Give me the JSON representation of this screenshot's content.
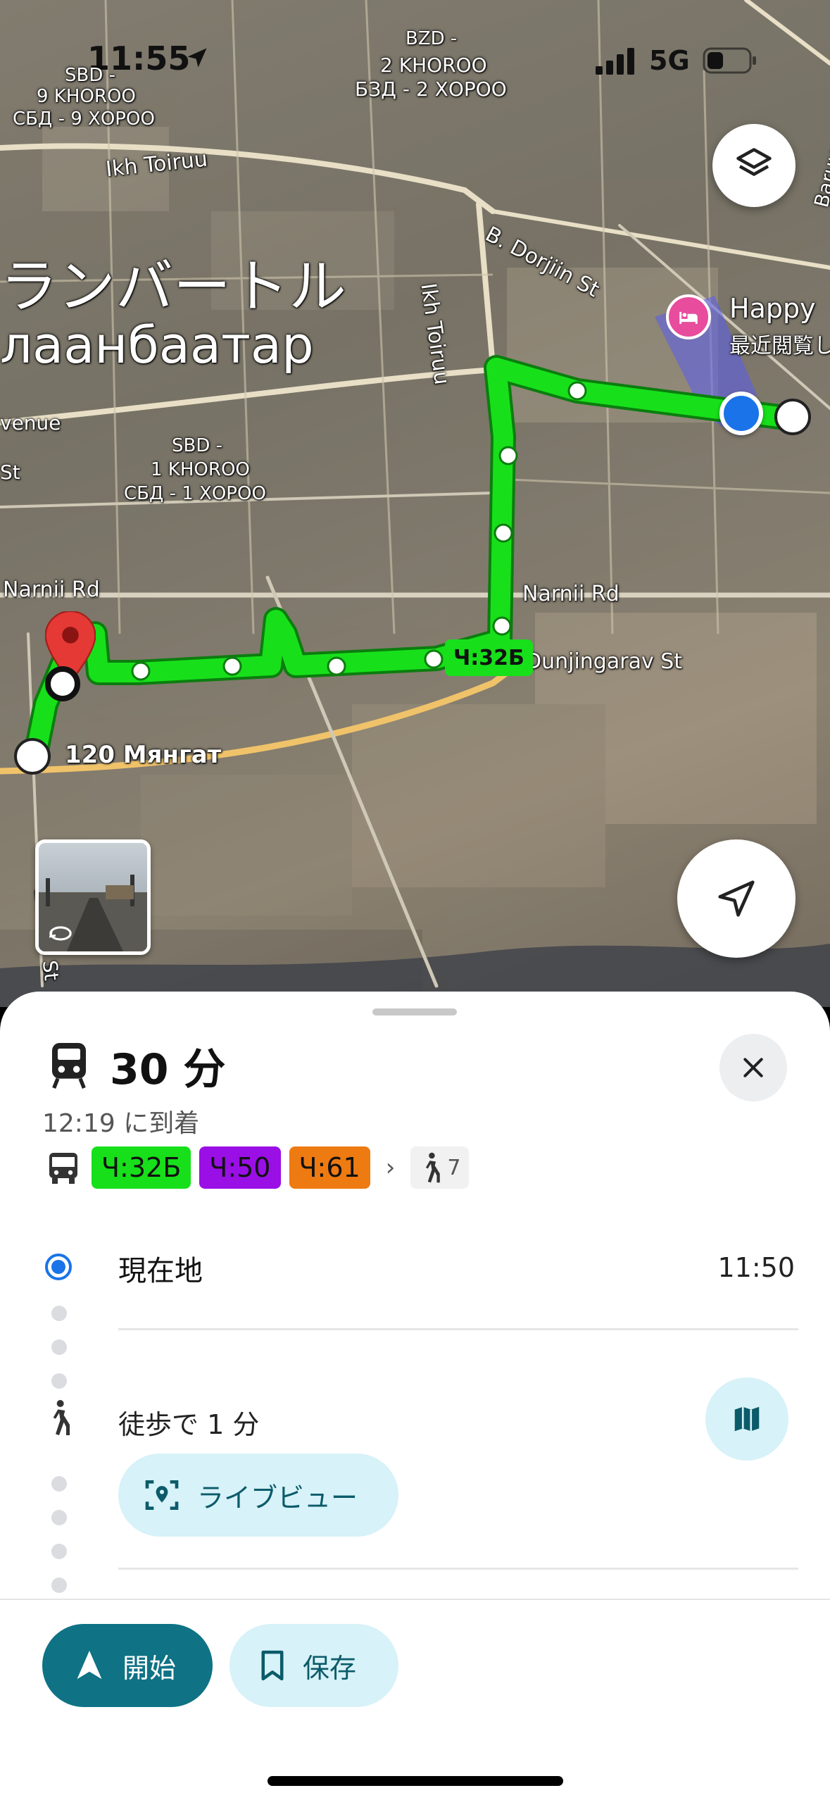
{
  "status_bar": {
    "time": "11:55",
    "network": "5G"
  },
  "map": {
    "labels": {
      "sbd9_line1": "SBD -",
      "sbd9_line2": "9 KHOROO",
      "sbd9_line3": "СБД - 9 ХОРОО",
      "bzd_line1": "BZD -",
      "bzd_line2": "2 KHOROO",
      "bzd_line3": "БЗД - 2 ХОРОО",
      "ikh_toiruu_h": "Ikh Toiruu",
      "ikh_toiruu_v": "Ikh Toiruu",
      "b_dorjiin": "B. Dorjiin St",
      "barun": "Baruun Altan-Ulgii",
      "city_jp": "ランバートル",
      "city_mn": "лаанбаатар",
      "avenue": "venue",
      "st": "St",
      "sbd1_line1": "SBD -",
      "sbd1_line2": "1 KHOROO",
      "sbd1_line3": "СБД - 1 ХОРОО",
      "narnii_left": "Narnii Rd",
      "narnii_right": "Narnii Rd",
      "dunjingarav": "Dunjingarav St",
      "stop_120": "120 Мянгат",
      "zaisan": "Zaisan St",
      "happy": "Happy",
      "happy_sub": "最近閲覧し",
      "route_badge": "Ч:32Б"
    }
  },
  "sheet": {
    "duration": "30 分",
    "arrival": "12:19 に到着",
    "routes": [
      {
        "label": "Ч:32Б",
        "color": "#17e01a"
      },
      {
        "label": "Ч:50",
        "color": "#9a0fe6"
      },
      {
        "label": "Ч:61",
        "color": "#ee7a12"
      }
    ],
    "walk_count": "7",
    "current_location": "現在地",
    "current_time": "11:50",
    "walk_step": "徒歩で 1 分",
    "live_view": "ライブビュー",
    "start": "開始",
    "save": "保存"
  },
  "colors": {
    "accent": "#0f7285",
    "route_green": "#17e01a",
    "current_blue": "#1a73e8",
    "pin_red": "#e53935"
  }
}
